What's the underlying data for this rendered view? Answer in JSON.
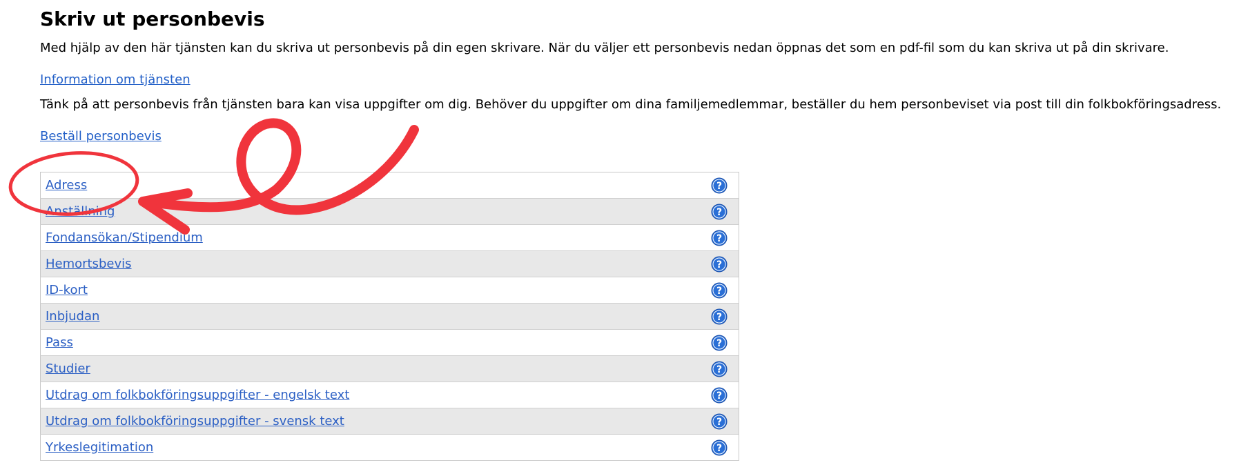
{
  "page": {
    "title": "Skriv ut personbevis",
    "intro": "Med hjälp av den här tjänsten kan du skriva ut personbevis på din egen skrivare. När du väljer ett personbevis nedan öppnas det som en pdf-fil som du kan skriva ut på din skrivare.",
    "info_link": "Information om tjänsten",
    "notice": "Tänk på att personbevis från tjänsten bara kan visa uppgifter om dig. Behöver du uppgifter om dina familjemedlemmar, beställer du hem personbeviset via post till din folkbokföringsadress.",
    "order_link": "Beställ personbevis"
  },
  "certificates": [
    {
      "label": "Adress",
      "help_icon": "question-mark-icon"
    },
    {
      "label": "Anställning",
      "help_icon": "question-mark-icon"
    },
    {
      "label": "Fondansökan/Stipendium",
      "help_icon": "question-mark-icon"
    },
    {
      "label": "Hemortsbevis",
      "help_icon": "question-mark-icon"
    },
    {
      "label": "ID-kort",
      "help_icon": "question-mark-icon"
    },
    {
      "label": "Inbjudan",
      "help_icon": "question-mark-icon"
    },
    {
      "label": "Pass",
      "help_icon": "question-mark-icon"
    },
    {
      "label": "Studier",
      "help_icon": "question-mark-icon"
    },
    {
      "label": "Utdrag om folkbokföringsuppgifter - engelsk text",
      "help_icon": "question-mark-icon"
    },
    {
      "label": "Utdrag om folkbokföringsuppgifter - svensk text",
      "help_icon": "question-mark-icon"
    },
    {
      "label": "Yrkeslegitimation",
      "help_icon": "question-mark-icon"
    }
  ],
  "colors": {
    "link": "#2b5fc4",
    "row_alt": "#e8e8e8",
    "help_icon": "#2a6fd6",
    "annotation": "#f0343c"
  }
}
